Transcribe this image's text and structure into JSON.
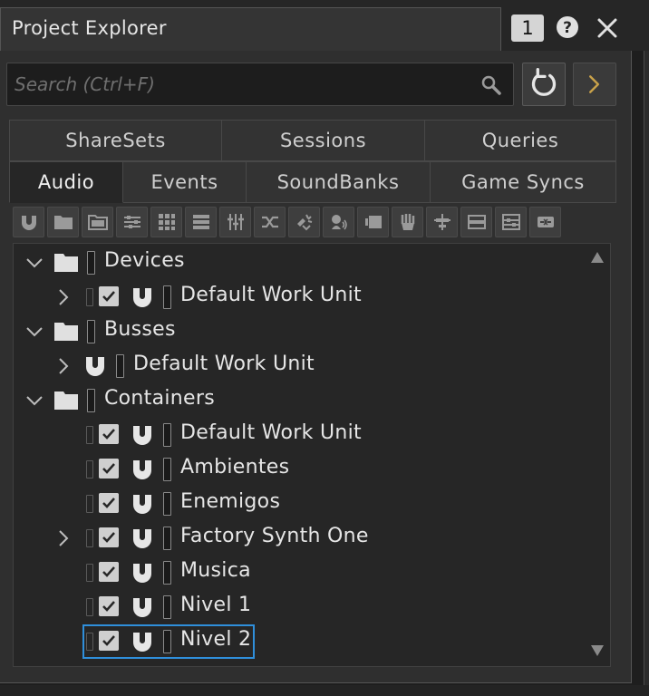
{
  "window": {
    "title": "Project Explorer",
    "instance_count": "1"
  },
  "search": {
    "placeholder": "Search (Ctrl+F)",
    "value": ""
  },
  "tabs_row1": [
    {
      "label": "ShareSets"
    },
    {
      "label": "Sessions"
    },
    {
      "label": "Queries"
    }
  ],
  "tabs_row2": [
    {
      "label": "Audio",
      "active": true
    },
    {
      "label": "Events"
    },
    {
      "label": "SoundBanks"
    },
    {
      "label": "Game Syncs"
    }
  ],
  "toolbar_icons": [
    "work-unit-icon",
    "folder-icon",
    "virtual-folder-icon",
    "actor-mixer-icon",
    "random-container-icon",
    "sequence-container-icon",
    "switch-container-icon",
    "blend-container-icon",
    "sound-sfx-icon",
    "sound-voice-icon",
    "audio-source-icon",
    "music-switch-icon",
    "music-playlist-icon",
    "music-segment-icon",
    "music-track-icon",
    "audio-bus-icon"
  ],
  "tree": {
    "items": [
      {
        "label": "Devices",
        "kind": "folder",
        "expanded": true
      },
      {
        "label": "Default Work Unit",
        "kind": "work-unit",
        "checked": true,
        "expandable": true
      },
      {
        "label": "Busses",
        "kind": "folder",
        "expanded": true
      },
      {
        "label": "Default Work Unit",
        "kind": "work-unit",
        "expandable": true
      },
      {
        "label": "Containers",
        "kind": "folder",
        "expanded": true
      },
      {
        "label": "Default Work Unit",
        "kind": "work-unit",
        "checked": true
      },
      {
        "label": "Ambientes",
        "kind": "work-unit",
        "checked": true
      },
      {
        "label": "Enemigos",
        "kind": "work-unit",
        "checked": true
      },
      {
        "label": "Factory Synth One",
        "kind": "work-unit",
        "checked": true,
        "expandable": true
      },
      {
        "label": "Musica",
        "kind": "work-unit",
        "checked": true
      },
      {
        "label": "Nivel 1",
        "kind": "work-unit",
        "checked": true
      },
      {
        "label": "Nivel 2",
        "kind": "work-unit",
        "checked": true,
        "focused": true
      }
    ]
  },
  "colors": {
    "focus_outline": "#2f8fdb",
    "accent_arrow": "#c9a24a"
  }
}
